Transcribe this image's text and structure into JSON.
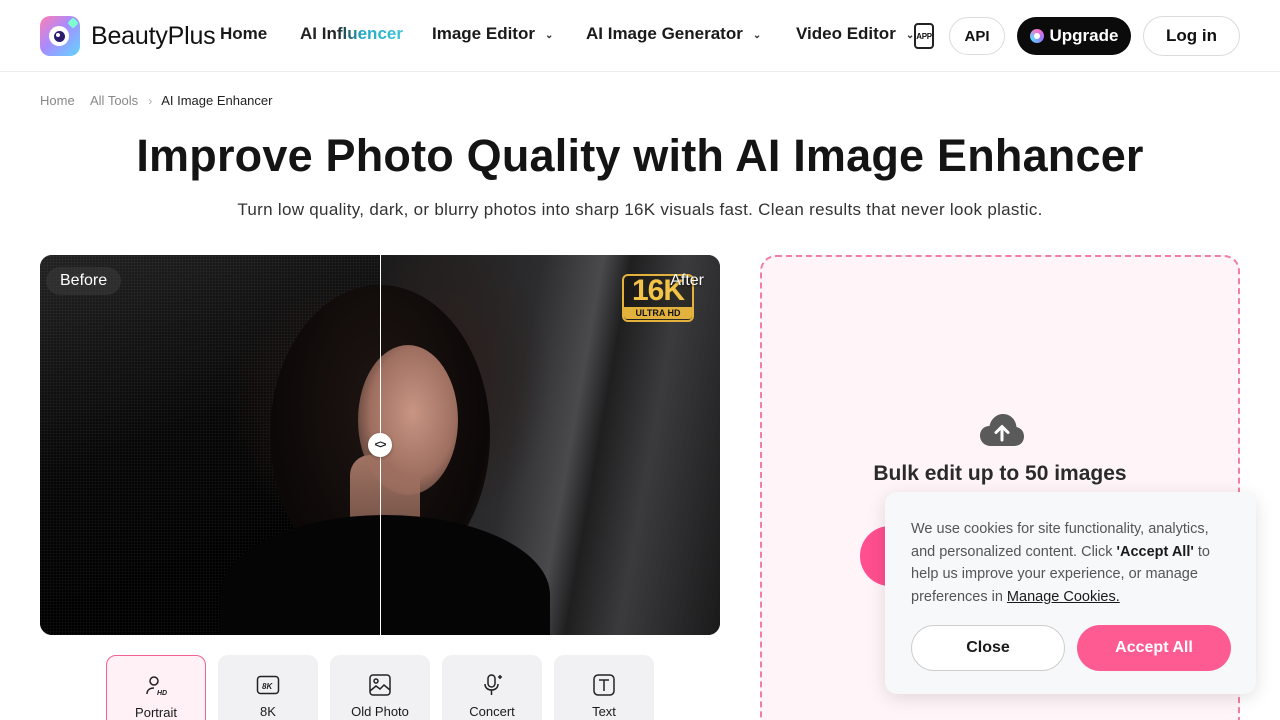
{
  "header": {
    "brand": "BeautyPlus",
    "nav": [
      {
        "label": "Home"
      },
      {
        "label": "AI Influencer"
      },
      {
        "label": "Image Editor"
      },
      {
        "label": "AI Image Generator"
      },
      {
        "label": "Video Editor"
      }
    ],
    "app_label": "APP",
    "api_label": "API",
    "upgrade_label": "Upgrade",
    "login_label": "Log in"
  },
  "breadcrumb": {
    "items": [
      "Home",
      "All Tools",
      "AI Image Enhancer"
    ]
  },
  "hero": {
    "title": "Improve Photo Quality with AI Image Enhancer",
    "subtitle": "Turn low quality, dark, or blurry photos into sharp 16K visuals fast. Clean results that never look plastic."
  },
  "compare": {
    "before_label": "Before",
    "after_label": "After",
    "badge_main": "16K",
    "badge_sub": "ULTRA HD"
  },
  "tools": {
    "tabs": [
      {
        "label": "Portrait",
        "icon": "portrait-hd-icon",
        "active": true
      },
      {
        "label": "8K",
        "icon": "8k-icon",
        "active": false
      },
      {
        "label": "Old Photo",
        "icon": "old-photo-icon",
        "active": false
      },
      {
        "label": "Concert",
        "icon": "microphone-icon",
        "active": false
      },
      {
        "label": "Text",
        "icon": "text-icon",
        "active": false
      }
    ]
  },
  "upload": {
    "heading": "Bulk edit up to 50 images"
  },
  "cookie": {
    "text_1": "We use cookies for site functionality, analytics, and personalized content. Click ",
    "text_bold": "'Accept All'",
    "text_2": " to help us improve your experience, or manage preferences in ",
    "link": "Manage Cookies.",
    "close_label": "Close",
    "accept_label": "Accept All"
  },
  "colors": {
    "accent_pink": "#ff5b93",
    "upload_border": "#f37ea3",
    "badge_gold": "#e3b23c"
  }
}
